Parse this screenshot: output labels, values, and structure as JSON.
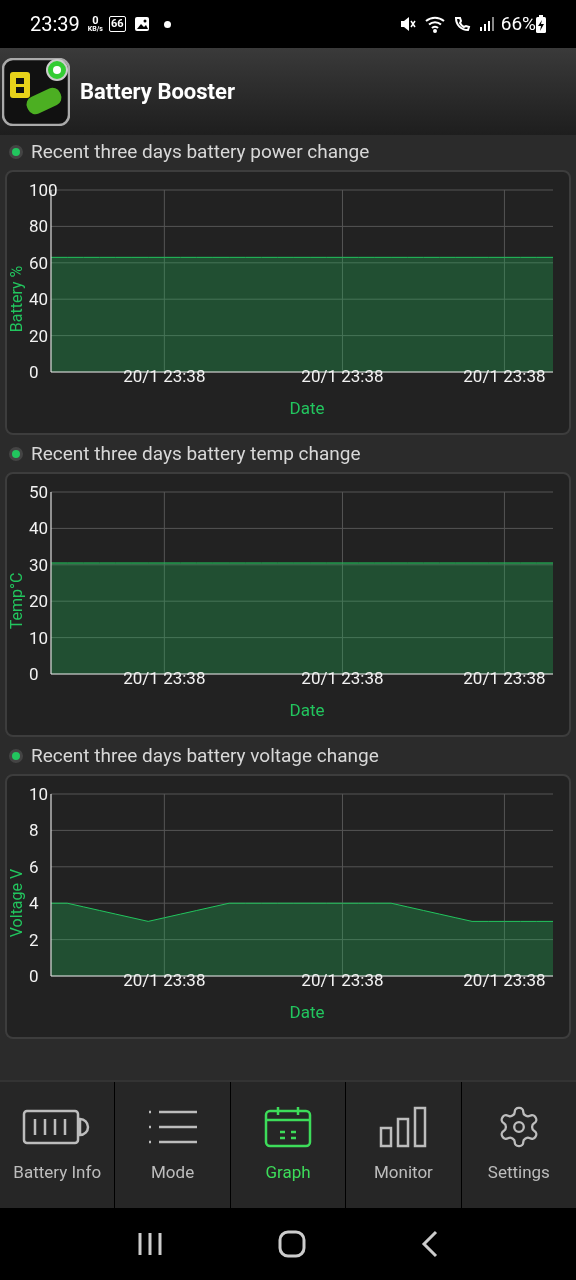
{
  "status_bar": {
    "time": "23:39",
    "net_speed": "0",
    "net_unit": "KB/s",
    "notification_count": "66",
    "battery": "66%"
  },
  "app_bar": {
    "title": "Battery Booster"
  },
  "sections": [
    {
      "title": "Recent three days battery power change",
      "chart_data": {
        "type": "area",
        "xlabel": "Date",
        "ylabel": "Battery %",
        "categories": [
          null,
          null,
          null,
          null,
          null,
          null,
          null,
          "20/1 23:38",
          null,
          null,
          null,
          null,
          null,
          null,
          null,
          null,
          null,
          null,
          "20/1 23:38",
          null,
          null,
          null,
          null,
          null,
          null,
          null,
          null,
          null,
          "20/1 23:38",
          null,
          null,
          null
        ],
        "grid": true,
        "series": [
          {
            "color": "#22c55e",
            "values": [
              63,
              63,
              63,
              63,
              63,
              63,
              63,
              63,
              63,
              63,
              63,
              63,
              63,
              63,
              63,
              63,
              63,
              63,
              63,
              63,
              63,
              63,
              63,
              63,
              63,
              63,
              63,
              63,
              63,
              63,
              63,
              63
            ]
          }
        ],
        "ylim": [
          0,
          100
        ],
        "yticks": [
          0,
          20,
          40,
          60,
          80,
          100
        ]
      }
    },
    {
      "title": "Recent three days battery temp change",
      "chart_data": {
        "type": "area",
        "xlabel": "Date",
        "ylabel": "Temp°C",
        "categories": [
          null,
          null,
          null,
          null,
          null,
          null,
          null,
          "20/1 23:38",
          null,
          null,
          null,
          null,
          null,
          null,
          null,
          null,
          null,
          null,
          "20/1 23:38",
          null,
          null,
          null,
          null,
          null,
          null,
          null,
          null,
          null,
          "20/1 23:38",
          null,
          null,
          null
        ],
        "grid": true,
        "series": [
          {
            "color": "#22c55e",
            "values": [
              30.5,
              30.5,
              30.5,
              30.5,
              30.5,
              30.5,
              30.5,
              30.5,
              30.5,
              30.5,
              30.5,
              30.5,
              30.5,
              30.5,
              30.5,
              30.5,
              30.5,
              30.5,
              30.5,
              30.5,
              30.5,
              30.5,
              30.5,
              30.5,
              30.5,
              30.5,
              30.5,
              30.5,
              30.5,
              30.5,
              30.5,
              30.5
            ]
          }
        ],
        "ylim": [
          0,
          50
        ],
        "yticks": [
          0,
          10,
          20,
          30,
          40,
          50
        ]
      }
    },
    {
      "title": "Recent three days battery voltage change",
      "chart_data": {
        "type": "area",
        "xlabel": "Date",
        "ylabel": "Voltage V",
        "categories": [
          null,
          null,
          null,
          null,
          null,
          null,
          null,
          "20/1 23:38",
          null,
          null,
          null,
          null,
          null,
          null,
          null,
          null,
          null,
          null,
          "20/1 23:38",
          null,
          null,
          null,
          null,
          null,
          null,
          null,
          null,
          null,
          "20/1 23:38",
          null,
          null,
          null
        ],
        "grid": true,
        "series": [
          {
            "color": "#22c55e",
            "values": [
              4,
              4,
              3.8,
              3.6,
              3.4,
              3.2,
              3,
              3.2,
              3.4,
              3.6,
              3.8,
              4,
              4,
              4,
              4,
              4,
              4,
              4,
              4,
              4,
              4,
              4,
              3.8,
              3.6,
              3.4,
              3.2,
              3,
              3,
              3,
              3,
              3,
              3
            ]
          }
        ],
        "ylim": [
          0,
          10
        ],
        "yticks": [
          0,
          2,
          4,
          6,
          8,
          10
        ]
      }
    }
  ],
  "bottom_nav": [
    {
      "label": "Battery Info",
      "selected": false
    },
    {
      "label": "Mode",
      "selected": false
    },
    {
      "label": "Graph",
      "selected": true
    },
    {
      "label": "Monitor",
      "selected": false
    },
    {
      "label": "Settings",
      "selected": false
    }
  ]
}
